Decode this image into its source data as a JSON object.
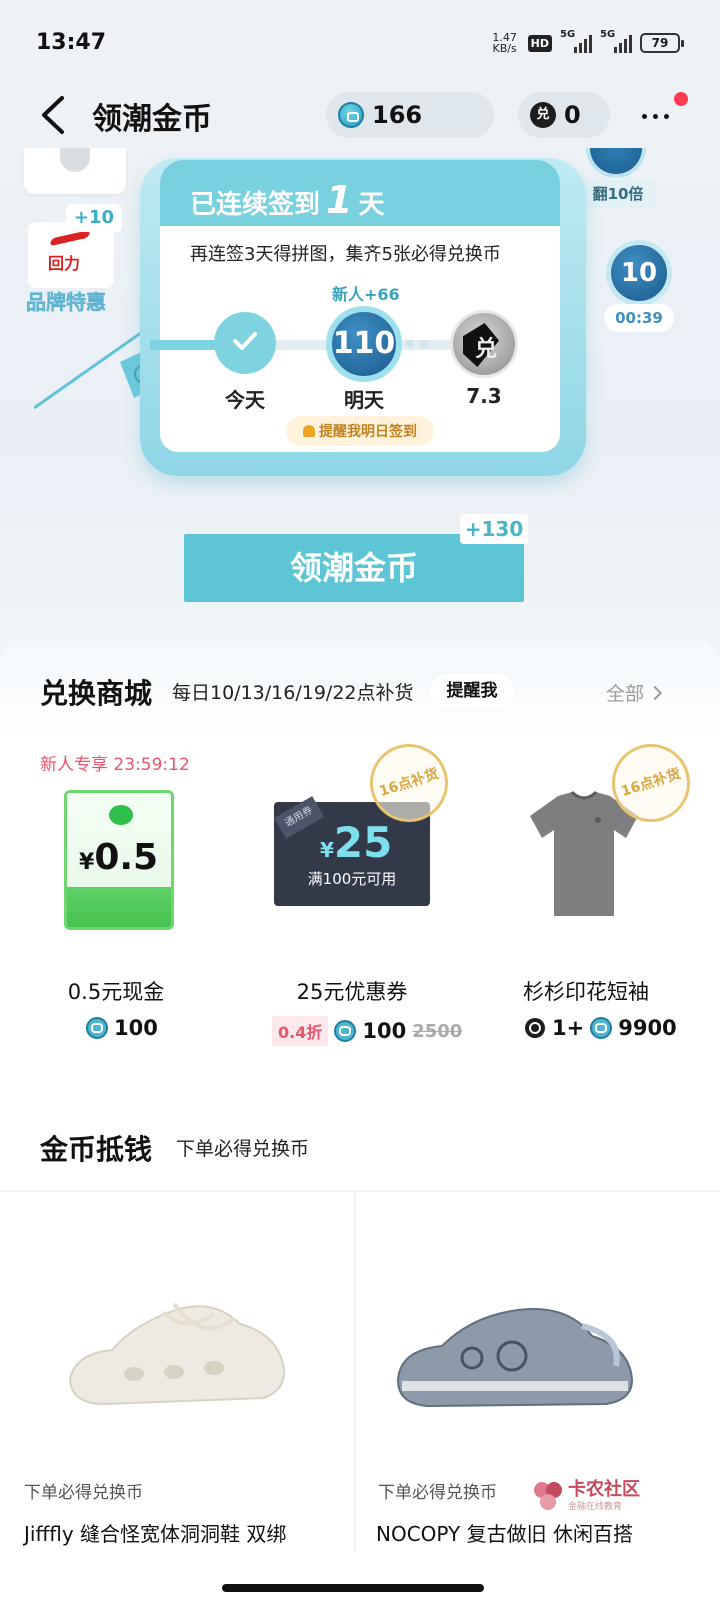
{
  "status_bar": {
    "time": "13:47",
    "net_speed_value": "1.47",
    "net_speed_unit": "KB/s",
    "hd": "HD",
    "sim1": "5G",
    "sim2": "5G",
    "battery": "79"
  },
  "header": {
    "title": "领潮金币",
    "coin_balance": "166",
    "token_balance": "0",
    "token_icon": "兑"
  },
  "left_widgets": {
    "brand_plus": "+10",
    "brand_logo": "回力",
    "brand_label": "品牌特惠"
  },
  "right_widgets": {
    "multiplier_label": "翻10倍",
    "timer_coin_value": "10",
    "timer": "00:39"
  },
  "signin": {
    "title_prefix": "已连续签到",
    "days": "1",
    "title_suffix": "天",
    "desc": "再连签3天得拼图，集齐5张必得兑换币",
    "newbie_bonus": "新人+66",
    "tomorrow_value": "110",
    "day_labels": [
      "今天",
      "明天",
      "7.3"
    ],
    "remind": "提醒我明日签到"
  },
  "claim": {
    "label": "领潮金币",
    "badge": "+130"
  },
  "exchange": {
    "title": "兑换商城",
    "subtitle": "每日10/13/16/19/22点补货",
    "remind_btn": "提醒我",
    "all_link": "全部",
    "newbie_timer": "新人专享 23:59:12",
    "stamp_text": "16点补货",
    "products": [
      {
        "name": "0.5元现金",
        "price": "100",
        "img_text": "¥0.5",
        "currency": "¥",
        "amount": "0.5"
      },
      {
        "name": "25元优惠券",
        "price": "100",
        "discount": "0.4折",
        "original": "2500",
        "coupon_corner": "通用券",
        "coupon_currency": "¥",
        "coupon_value": "25",
        "coupon_cond": "满100元可用"
      },
      {
        "name": "杉杉印花短袖",
        "token_qty": "1+",
        "price": "9900"
      }
    ]
  },
  "coin_discount": {
    "title": "金币抵钱",
    "subtitle": "下单必得兑换币",
    "items": [
      {
        "tag": "下单必得兑换币",
        "name": "Jifffly 缝合怪宽体洞洞鞋 双绑"
      },
      {
        "tag": "下单必得兑换币",
        "name": "NOCOPY 复古做旧 休闲百搭"
      }
    ]
  },
  "watermark": {
    "name": "卡农社区",
    "sub": "金融在线教育"
  }
}
